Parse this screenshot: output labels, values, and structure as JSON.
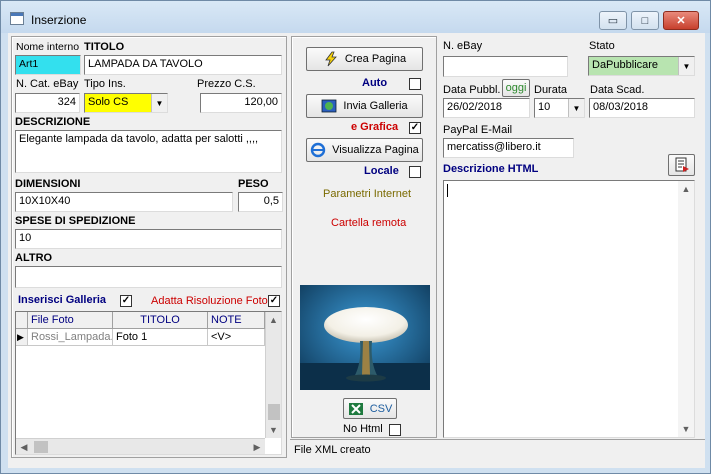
{
  "window": {
    "title": "Inserzione"
  },
  "titlebar_buttons": {
    "minimize": "▭",
    "maximize": "□",
    "close": "✕"
  },
  "left": {
    "nome_interno": {
      "label": "Nome interno",
      "value": "Art1"
    },
    "titolo": {
      "label": "TITOLO",
      "value": "LAMPADA DA TAVOLO"
    },
    "n_cat_ebay": {
      "label": "N. Cat. eBay",
      "value": "324"
    },
    "tipo_ins": {
      "label": "Tipo Ins.",
      "value": "Solo CS"
    },
    "prezzo_cs": {
      "label": "Prezzo C.S.",
      "value": "120,00"
    },
    "descrizione": {
      "label": "DESCRIZIONE",
      "value": "Elegante lampada da tavolo, adatta per salotti ,,,,"
    },
    "dimensioni": {
      "label": "DIMENSIONI",
      "value": "10X10X40"
    },
    "peso": {
      "label": "PESO",
      "value": "0,5"
    },
    "spese": {
      "label": "SPESE DI SPEDIZIONE",
      "value": "10"
    },
    "altro": {
      "label": "ALTRO",
      "value": ""
    },
    "inserisci_galleria": {
      "label": "Inserisci Galleria",
      "checked": "✓"
    },
    "adatta_risoluzione": {
      "label": "Adatta Risoluzione Foto",
      "checked": "✓"
    },
    "grid": {
      "columns": [
        "File Foto",
        "TITOLO",
        "NOTE"
      ],
      "rows": [
        {
          "marker": "▶",
          "file": "Rossi_Lampada...",
          "titolo": "Foto 1",
          "note": "<V>"
        }
      ]
    }
  },
  "middle": {
    "crea_pagina": "Crea Pagina",
    "auto": "Auto",
    "invia_galleria": "Invia Galleria",
    "e_grafica": {
      "label": "e Grafica",
      "checked": "✓"
    },
    "visualizza_pagina": "Visualizza Pagina",
    "locale": "Locale",
    "parametri_internet": "Parametri Internet",
    "cartella_remota": "Cartella remota",
    "csv": "CSV",
    "no_html": "No Html"
  },
  "right": {
    "n_ebay": {
      "label": "N. eBay",
      "value": ""
    },
    "stato": {
      "label": "Stato",
      "value": "DaPubblicare"
    },
    "data_pubbl": {
      "label": "Data Pubbl.",
      "oggi": "oggi",
      "value": "26/02/2018"
    },
    "durata": {
      "label": "Durata",
      "value": "10"
    },
    "data_scad": {
      "label": "Data Scad.",
      "value": "08/03/2018"
    },
    "paypal": {
      "label": "PayPal E-Mail",
      "value": "mercatiss@libero.it"
    },
    "descrizione_html": {
      "label": "Descrizione HTML"
    }
  },
  "status": {
    "text": "File XML creato"
  },
  "colors": {
    "accent_cyan": "#33e0ee",
    "accent_yellow": "#ffff00",
    "accent_green": "#b8e4b0",
    "red_label": "#cc0000",
    "olive_link": "#7a6a00"
  }
}
